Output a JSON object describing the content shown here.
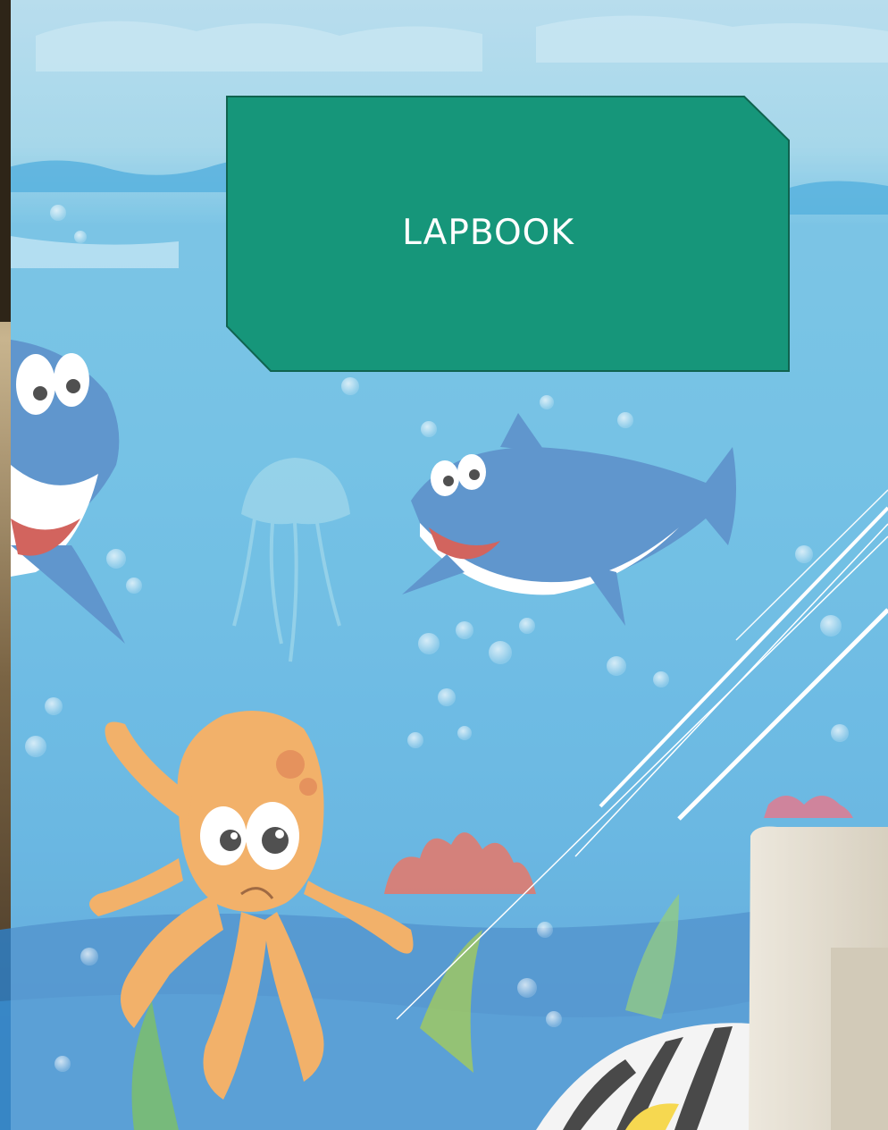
{
  "slide": {
    "title": "LAPBOOK"
  },
  "theme": {
    "title_box_fill": "#16967A",
    "title_box_border": "#10634F",
    "deco_line_color": "#ffffff"
  },
  "background": {
    "scene": "underwater-ocean-mural",
    "elements": [
      "shark-illustration",
      "shark-illustration",
      "octopus-illustration",
      "jellyfish-illustration",
      "coral-illustration",
      "striped-fish-illustration",
      "bubbles",
      "couch-photo"
    ]
  }
}
